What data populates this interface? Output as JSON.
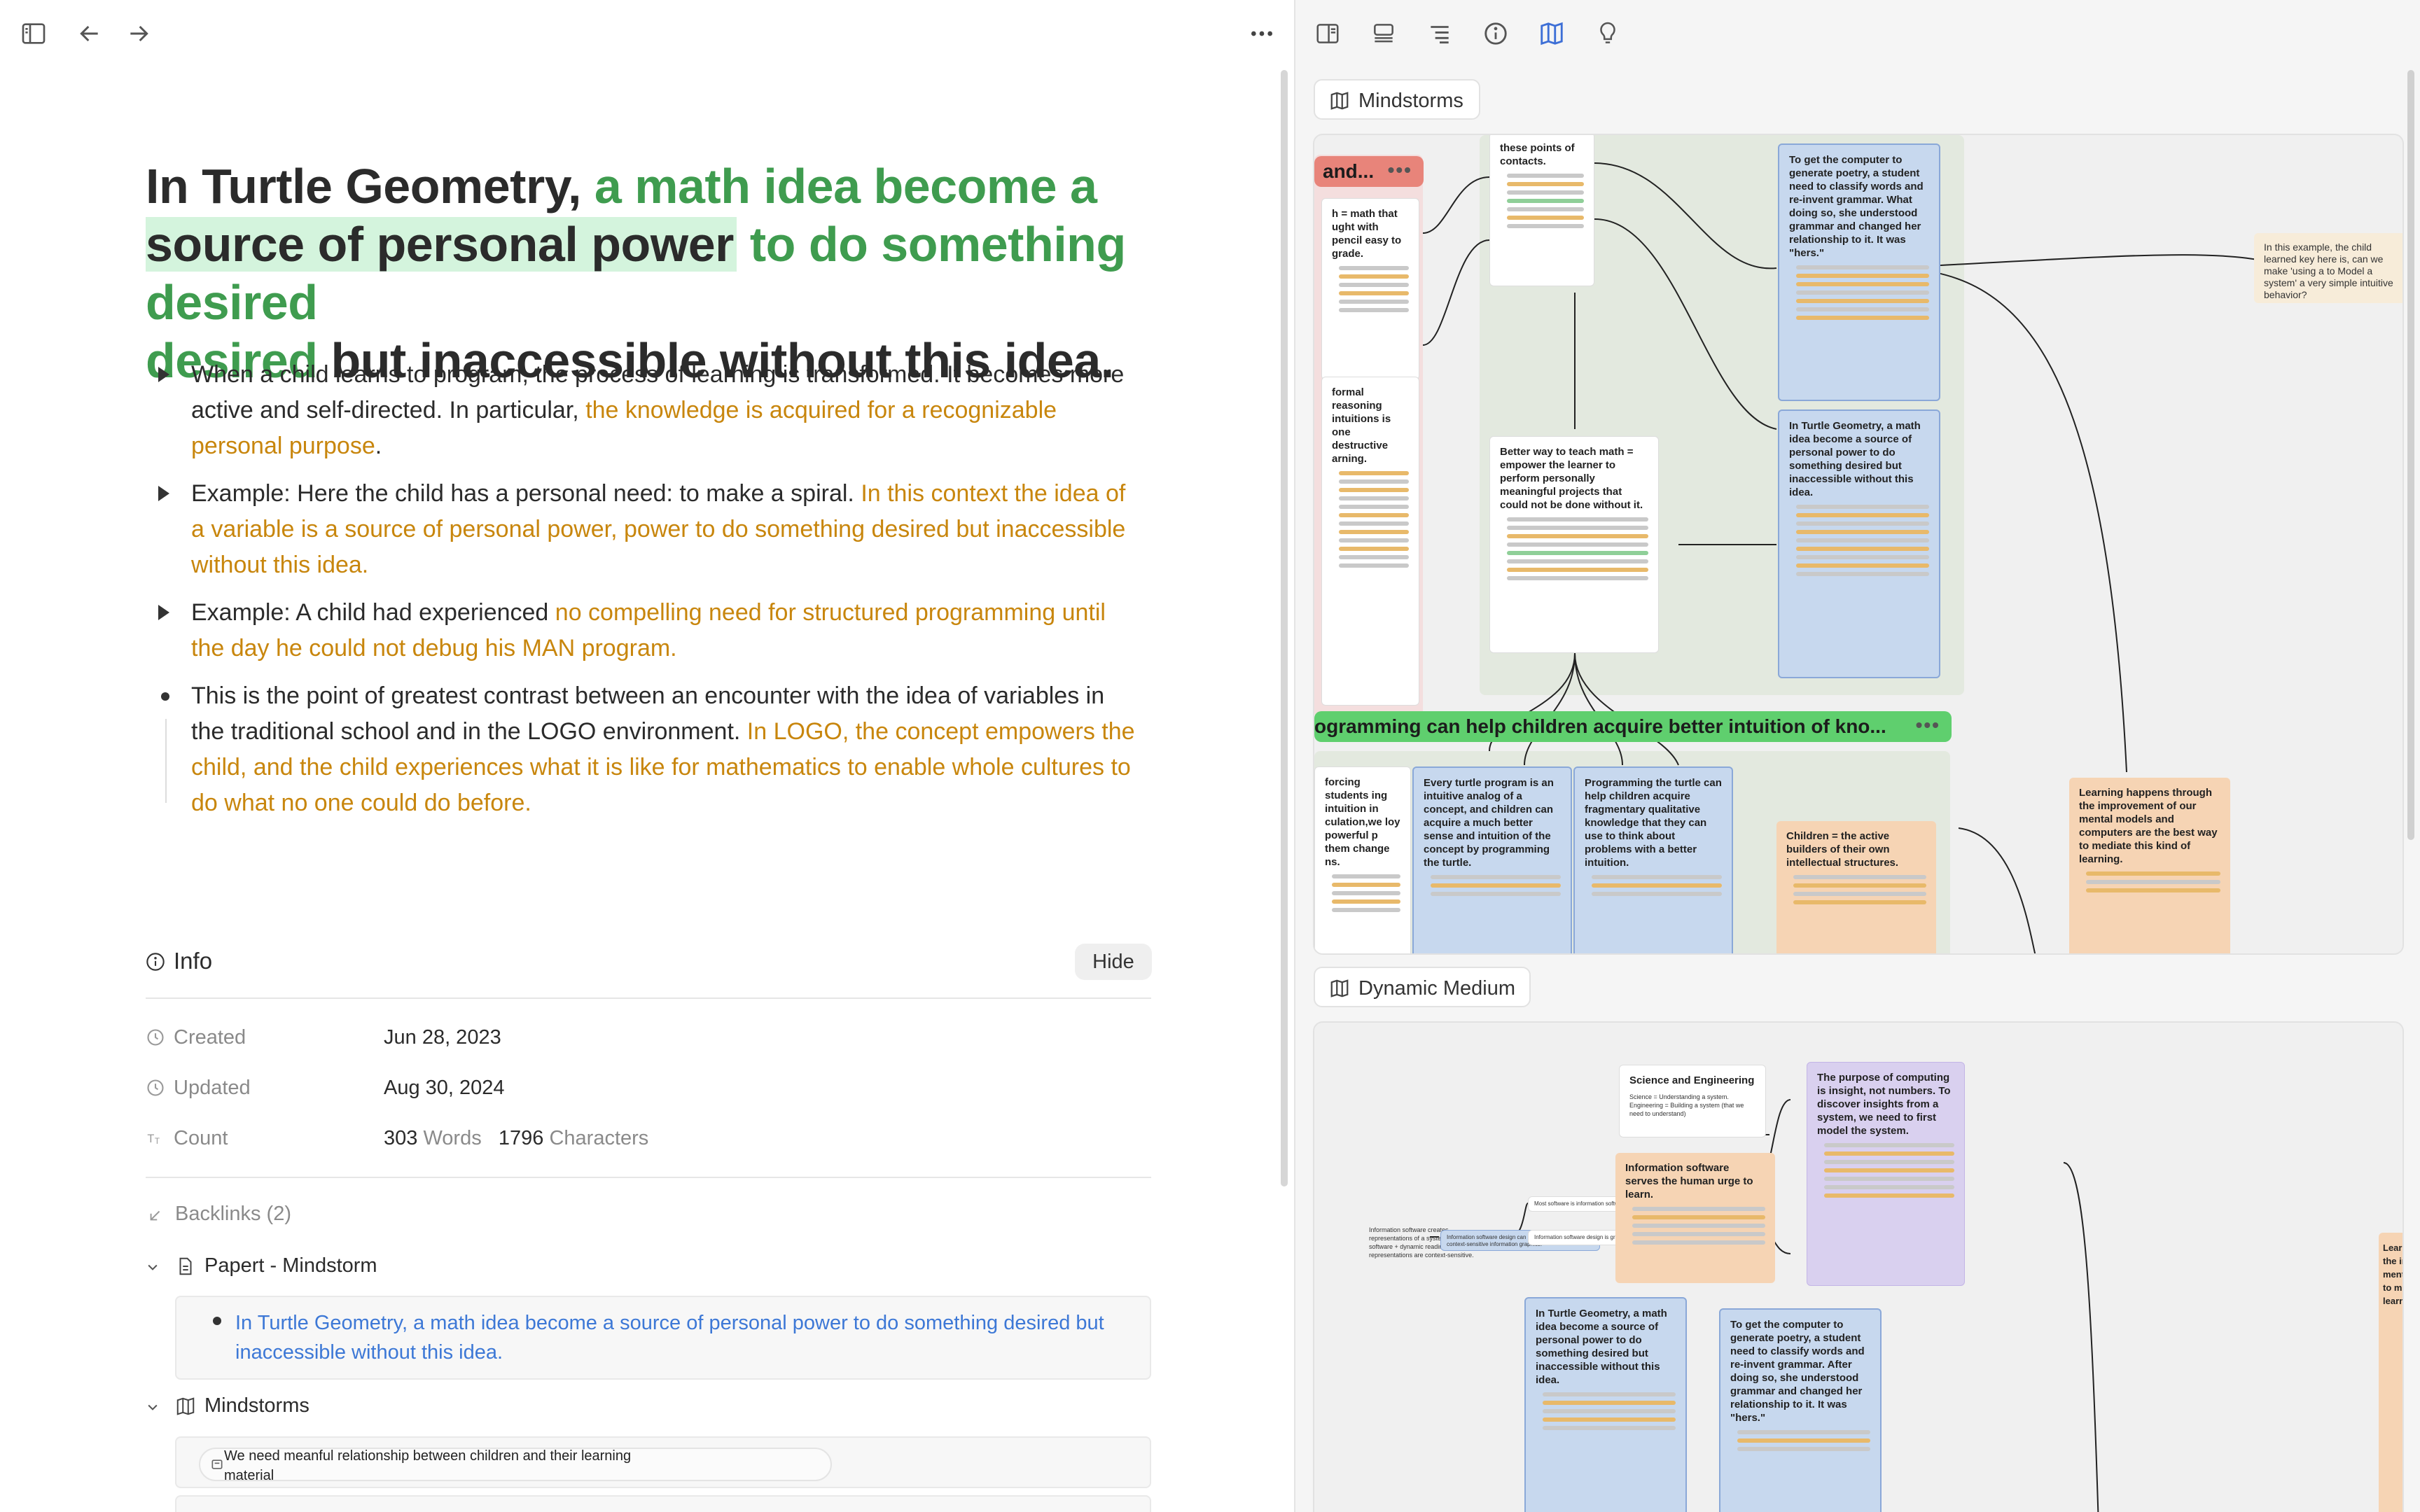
{
  "toolbar_left": {
    "icons": [
      "sidebar-toggle-icon",
      "back-arrow-icon",
      "forward-arrow-icon",
      "more-horizontal-icon"
    ]
  },
  "toolbar_right": {
    "icons": [
      "split-view-icon",
      "stack-view-icon",
      "outline-list-icon",
      "info-icon",
      "map-book-icon",
      "lightbulb-icon"
    ],
    "active_icon": "map-book-icon",
    "active_color": "#3d6fd6"
  },
  "title": {
    "part1": "In Turtle Geometry, ",
    "part2": "a math idea become a",
    "part3": "source of personal power",
    "part4": " to do something desired",
    "part5": " but inaccessible without this idea."
  },
  "bullets": [
    {
      "marker": "collapsed",
      "text": "When a child learns to program, the process of learning is transformed. It becomes more active and self-directed. In particular, ",
      "highlight": "the knowledge is acquired for a recognizable personal purpose",
      "tail": "."
    },
    {
      "marker": "collapsed",
      "text": "Example: Here the child has a personal need: to make a spiral. ",
      "highlight": "In this context the idea of a variable is a source of personal power, power to do something desired but inaccessible without this idea.",
      "tail": ""
    },
    {
      "marker": "collapsed",
      "text": "Example: A child had experienced ",
      "highlight": "no compelling need for structured programming until the day he could not debug his MAN program.",
      "tail": ""
    },
    {
      "marker": "dot",
      "text": "This is the point of greatest contrast between an encounter with the idea of variables in the traditional school and in the LOGO environment. ",
      "highlight": "In LOGO, the concept empowers the child, and the child experiences what it is like for mathematics to enable whole cultures to do what no one could do before.",
      "tail": ""
    }
  ],
  "info": {
    "heading": "Info",
    "hide_label": "Hide",
    "created_label": "Created",
    "created_value": "Jun 28, 2023",
    "updated_label": "Updated",
    "updated_value": "Aug 30, 2024",
    "count_label": "Count",
    "words_value": "303",
    "words_label": "Words",
    "chars_value": "1796",
    "chars_label": "Characters"
  },
  "backlinks": {
    "heading": "Backlinks (2)",
    "groups": [
      {
        "title": "Papert - Mindstorm",
        "icon": "document-icon",
        "items": [
          "In Turtle Geometry, a math idea become a source of personal power to do something desired but inaccessible without this idea."
        ]
      },
      {
        "title": "Mindstorms",
        "icon": "map-book-icon",
        "items": [
          "We need meanful relationship between children and their learning material"
        ]
      }
    ]
  },
  "boards": {
    "mindstorms_label": "Mindstorms",
    "dynamic_label": "Dynamic Medium",
    "board1": {
      "pill_red": "and...",
      "pill_green": "ogramming can help children acquire better intuition of kno...",
      "card_contacts": "these points of contacts.",
      "card_computer_poetry": "To get the computer to generate poetry, a student need to classify words and re-invent grammar. What doing so, she understood grammar and changed her relationship to it. It was \"hers.\"",
      "card_turtle": "In Turtle Geometry, a math idea become a source of personal power to do something desired but inaccessible without this idea.",
      "card_better_way": "Better way to teach math = empower the learner to perform personally meaningful projects that could not be done without it.",
      "card_left_math": "h = math that ught with pencil easy to grade.",
      "card_left_reasoning": "formal reasoning intuitions is one destructive arning.",
      "card_example": "In this example, the child learned key here is, can we make 'using a to Model a system' a very simple intuitive behavior?",
      "card_every_turtle": "Every turtle program is an intuitive analog of a concept, and children can acquire a much better sense and intuition of the concept by programming the turtle.",
      "card_programming_turtle": "Programming the turtle can help children acquire fragmentary qualitative knowledge that they can use to think about problems with a better intuition.",
      "card_builders": "Children = the active builders of their own intellectual structures.",
      "card_learning": "Learning happens through the improvement of our mental models and computers are the best way to mediate this kind of learning.",
      "card_forcing": "forcing students ing intuition in culation,we loy powerful p them change ns."
    },
    "board2": {
      "card_science": "Science and Engineering",
      "card_science_body": "Science = Understanding a system. Engineering = Building a system (that we need to understand)",
      "card_purpose": "The purpose of computing is insight, not numbers. To discover insights from a system, we need to first model the system.",
      "card_info_serves": "Information software serves the human urge to learn.",
      "node_info_sw": "Information software design can be seen as the design of context-sensitive information graphics.",
      "node_most_sw": "Most software is information software.",
      "node_graphic": "Information software design is graphic design",
      "left_text": "Information software creates representations of a system. = Information software + dynamic reading, where representations are context-sensitive.",
      "card_turtle2": "In Turtle Geometry, a math idea become a source of personal power to do something desired but inaccessible without this idea.",
      "card_poetry2": "To get the computer to generate poetry, a student need to classify words and re-invent grammar. After doing so, she understood grammar and changed her relationship to it. It was \"hers.\"",
      "card_edge": "Learn the imp menta to me learni"
    }
  }
}
